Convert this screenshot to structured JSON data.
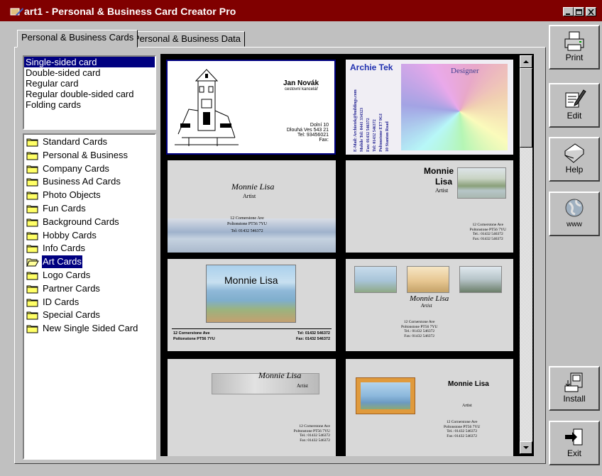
{
  "window": {
    "title": "art1 - Personal & Business Card Creator Pro"
  },
  "tabs": [
    "Personal & Business Cards",
    "Personal & Business Data"
  ],
  "card_types": {
    "items": [
      "Single-sided card",
      "Double-sided card",
      "Regular card",
      "Regular double-sided card",
      "Folding cards"
    ],
    "selected": "Single-sided card"
  },
  "categories": {
    "items": [
      "Standard Cards",
      "Personal & Business",
      "Company Cards",
      "Business Ad Cards",
      "Photo Objects",
      "Fun Cards",
      "Background Cards",
      "Hobby Cards",
      "Info Cards",
      "Art Cards",
      "Logo Cards",
      "Partner Cards",
      "ID Cards",
      "Special Cards",
      "New Single Sided Card"
    ],
    "selected": "Art Cards"
  },
  "toolbar": {
    "print": "Print",
    "edit": "Edit",
    "help": "Help",
    "www": "www",
    "install": "Install",
    "exit": "Exit"
  },
  "cards": {
    "c1": {
      "name": "Jan Novák",
      "subtitle": "cestovní kancelář",
      "addr1": "Dolní 10",
      "addr2": "Dlouhá Ves 543 21",
      "tel": "Tel: 93456021",
      "fax": "Fax:"
    },
    "c2": {
      "name": "Archie Tek",
      "title": "Designer",
      "v1": "10 Stanton Road",
      "v2": "Poltonstone ET7 9GI",
      "v3": "Tel: 01432 546372",
      "v4": "Fax: 01432 546372",
      "v5": "Mobile Tel: 0441 334323",
      "v6": "E-Mail: Archietek@buildings.com"
    },
    "c3": {
      "name": "Monnie Lisa",
      "title": "Artist",
      "addr1": "12 Cornerstone Ave",
      "addr2": "Poltonstone PT56 7YU",
      "tel": "Tel: 01432 546372"
    },
    "c4": {
      "name1": "Monnie",
      "name2": "Lisa",
      "title": "Artist",
      "addr1": "12 Cornerstone Ave",
      "addr2": "Poltonstone PT56 7YU",
      "tel": "Tel.: 01432 546372",
      "fax": "Fax: 01432 546372"
    },
    "c5": {
      "name": "Monnie Lisa",
      "addr1": "12 Cornerstone Ave",
      "addr2": "Poltonstone PT56 7YU",
      "tel": "Tel: 01432 546372",
      "fax": "Fax: 01432 546372"
    },
    "c6": {
      "name": "Monnie Lisa",
      "title": "Artist",
      "addr1": "12 Cornerstone Ave",
      "addr2": "Poltonstone PT56 7YU",
      "tel": "Tel.: 01432 546372",
      "fax": "Fax: 01432 546372"
    },
    "c7": {
      "name": "Monnie Lisa",
      "title": "Artist",
      "addr1": "12 Cornerstone Ave",
      "addr2": "Poltonstone PT56 7YU",
      "tel": "Tel.: 01432 546372",
      "fax": "Fax: 01432 546372"
    },
    "c8": {
      "name": "Monnie Lisa",
      "title": "Artist",
      "addr1": "12 Cornerstone Ave",
      "addr2": "Poltonstone PT56 7YU",
      "tel": "Tel.: 01432 546372",
      "fax": "Fax: 01432 546372"
    }
  },
  "colors": {
    "titlebar": "#800000",
    "selection": "#000080",
    "face": "#c0c0c0"
  }
}
